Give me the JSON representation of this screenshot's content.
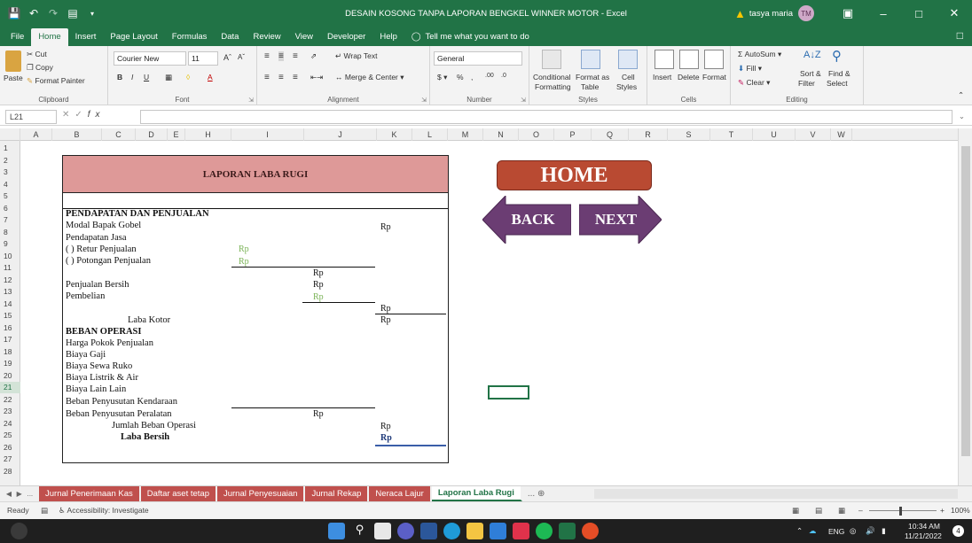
{
  "window": {
    "title": "DESAIN KOSONG TANPA LAPORAN BENGKEL WINNER MOTOR - Excel",
    "user_name": "tasya maria",
    "user_initials": "TM"
  },
  "ribbon_tabs": [
    "File",
    "Home",
    "Insert",
    "Page Layout",
    "Formulas",
    "Data",
    "Review",
    "View",
    "Developer",
    "Help"
  ],
  "tell_me": "Tell me what you want to do",
  "ribbon": {
    "clipboard": {
      "paste": "Paste",
      "cut": "Cut",
      "copy": "Copy",
      "format_painter": "Format Painter",
      "label": "Clipboard"
    },
    "font": {
      "name": "Courier New",
      "size": "11",
      "label": "Font"
    },
    "alignment": {
      "wrap_text": "Wrap Text",
      "merge_center": "Merge & Center",
      "label": "Alignment"
    },
    "number": {
      "format": "General",
      "label": "Number"
    },
    "styles": {
      "conditional": "Conditional",
      "conditional2": "Formatting",
      "format_as": "Format as",
      "format_as2": "Table",
      "cell": "Cell",
      "cell2": "Styles",
      "label": "Styles"
    },
    "cells": {
      "insert": "Insert",
      "delete": "Delete",
      "format": "Format",
      "label": "Cells"
    },
    "editing": {
      "autosum": "AutoSum",
      "fill": "Fill",
      "clear": "Clear",
      "sort": "Sort &",
      "sort2": "Filter",
      "find": "Find &",
      "find2": "Select",
      "label": "Editing"
    }
  },
  "formula_bar": {
    "name_box": "L21",
    "fx": "fx"
  },
  "columns": [
    "A",
    "B",
    "C",
    "D",
    "E",
    "H",
    "I",
    "J",
    "K",
    "L",
    "M",
    "N",
    "O",
    "P",
    "Q",
    "R",
    "S",
    "T",
    "U",
    "V",
    "W"
  ],
  "rows": [
    "1",
    "2",
    "3",
    "4",
    "5",
    "6",
    "7",
    "8",
    "9",
    "10",
    "11",
    "12",
    "13",
    "14",
    "15",
    "16",
    "17",
    "18",
    "19",
    "20",
    "21",
    "22",
    "23",
    "24",
    "25",
    "26",
    "27",
    "28"
  ],
  "report": {
    "title": "LAPORAN LABA RUGI",
    "lines": [
      "PENDAPATAN DAN PENJUALAN",
      "Modal Bapak Gobel",
      "Pendapatan Jasa",
      "( ) Retur Penjualan",
      "( ) Potongan Penjualan",
      "Penjualan Bersih",
      "Pembelian",
      "Laba Kotor",
      "BEBAN OPERASI",
      "Harga Pokok Penjualan",
      "Biaya Gaji",
      "Biaya Sewa Ruko",
      "Biaya Listrik & Air",
      "Biaya Lain Lain",
      "Beban Penyusutan Kendaraan",
      "Beban Penyusutan Peralatan",
      "Jumlah Beban Operasi",
      "Laba Bersih"
    ],
    "currency": "Rp"
  },
  "buttons": {
    "home": "HOME",
    "back": "BACK",
    "next": "NEXT"
  },
  "sheet_tabs": [
    "Jurnal Penerimaan Kas",
    "Daftar aset tetap",
    "Jurnal Penyesuaian",
    "Jurnal Rekap",
    "Neraca Lajur",
    "Laporan Laba Rugi"
  ],
  "status": {
    "ready": "Ready",
    "accessibility": "Accessibility: Investigate",
    "zoom": "100%"
  },
  "taskbar": {
    "lang": "ENG",
    "time": "10:34 AM",
    "date": "11/21/2022",
    "notif": "4"
  },
  "colors": {
    "excel_green": "#217346",
    "report_header": "#de9998",
    "home_button": "#b94a32",
    "arrow_button": "#6b3d73",
    "sheet_tab": "#c0504d"
  }
}
